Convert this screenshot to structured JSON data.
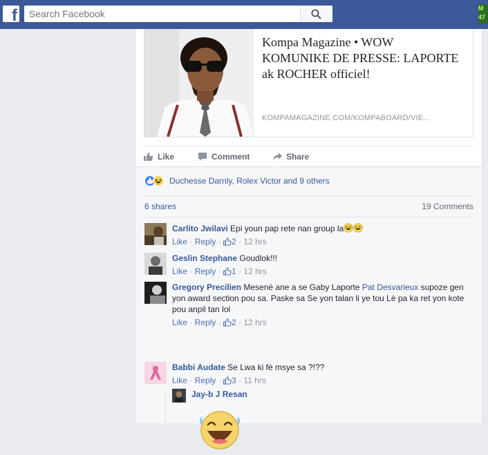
{
  "topbar": {
    "logo_letter": "f",
    "search_placeholder": "Search Facebook",
    "badge_lines": [
      "M",
      "47"
    ],
    "color": "#3b5998"
  },
  "post": {
    "link_preview": {
      "title": "Kompa Magazine • WOW KOMUNIKE DE PRESSE: LAPORTE ak ROCHER officiel!",
      "domain": "KOMPAMAGAZINE.COM/KOMPABOARD/VIE..."
    },
    "actions": {
      "like": "Like",
      "comment": "Comment",
      "share": "Share"
    },
    "reactions": {
      "names": "Duchesse Darnly, Rolex Victor and 9 others",
      "types": [
        "like-icon",
        "haha-icon"
      ]
    },
    "shares": "6 shares",
    "comments_count": "19 Comments"
  },
  "comments": [
    {
      "author": "Carlito Jwilavi",
      "text": "Epi youn pap rete nan group la",
      "emoji": [
        "laugh-cry-icon",
        "laugh-cry-icon"
      ],
      "like": "Like",
      "reply": "Reply",
      "likes": "2",
      "time": "12 hrs"
    },
    {
      "author": "Geslin Stephane",
      "text": "Goudlok!!!",
      "like": "Like",
      "reply": "Reply",
      "likes": "1",
      "time": "12 hrs"
    },
    {
      "author": "Gregory Precilien",
      "text_before": "Mesenè ane a se Gaby Laporte",
      "tag": "Pat Desvarieux",
      "text_after": "supoze gen yon award section pou sa. Paske sa Se yon talan li ye tou Lè pa ka ret yon kote pou anpil tan lol",
      "like": "Like",
      "reply": "Reply",
      "likes": "2",
      "time": "12 hrs"
    },
    {
      "author": "Babbi Audate",
      "text": "Se Lwa ki fè msye sa ?!??",
      "like": "Like",
      "reply": "Reply",
      "likes": "3",
      "time": "11 hrs"
    }
  ],
  "reply": {
    "author": "Jay-b J Resan",
    "sticker": "laughing-face-sticker"
  },
  "colors": {
    "link": "#365899",
    "meta": "#90949c",
    "accent": "#3b5998"
  }
}
